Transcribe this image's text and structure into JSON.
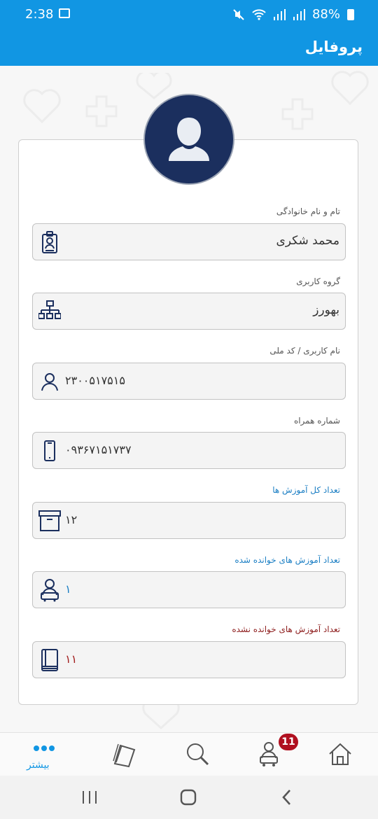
{
  "status_bar": {
    "time": "2:38",
    "battery": "88%"
  },
  "app_bar": {
    "title": "پروفایل"
  },
  "fields": [
    {
      "label": "تام و نام خانوادگی",
      "value": "محمد شکری",
      "icon": "id-badge-icon"
    },
    {
      "label": "گروه کاربری",
      "value": "بهورز",
      "icon": "org-chart-icon"
    },
    {
      "label": "نام کاربری / کد ملی",
      "value": "۲۳۰۰۵۱۷۵۱۵",
      "icon": "user-icon"
    },
    {
      "label": "شماره همراه",
      "value": "۰۹۳۶۷۱۵۱۷۳۷",
      "icon": "phone-icon"
    },
    {
      "label": "تعداد کل آموزش ها",
      "value": "۱۲",
      "icon": "archive-box-icon"
    },
    {
      "label": "تعداد آموزش های خوانده شده",
      "value": "۱",
      "icon": "reader-user-icon"
    },
    {
      "label": "تعداد آموزش های خوانده نشده",
      "value": "۱۱",
      "icon": "book-icon"
    }
  ],
  "bottom_nav": {
    "more_label": "بیشتر",
    "badge_count": "11",
    "items": [
      "more-icon",
      "books-icon",
      "search-icon",
      "user-cart-icon",
      "home-icon"
    ]
  },
  "colors": {
    "primary": "#1196e3",
    "avatar_bg": "#1b2f5e",
    "icon": "#1b2f5e",
    "badge": "#b01020"
  }
}
